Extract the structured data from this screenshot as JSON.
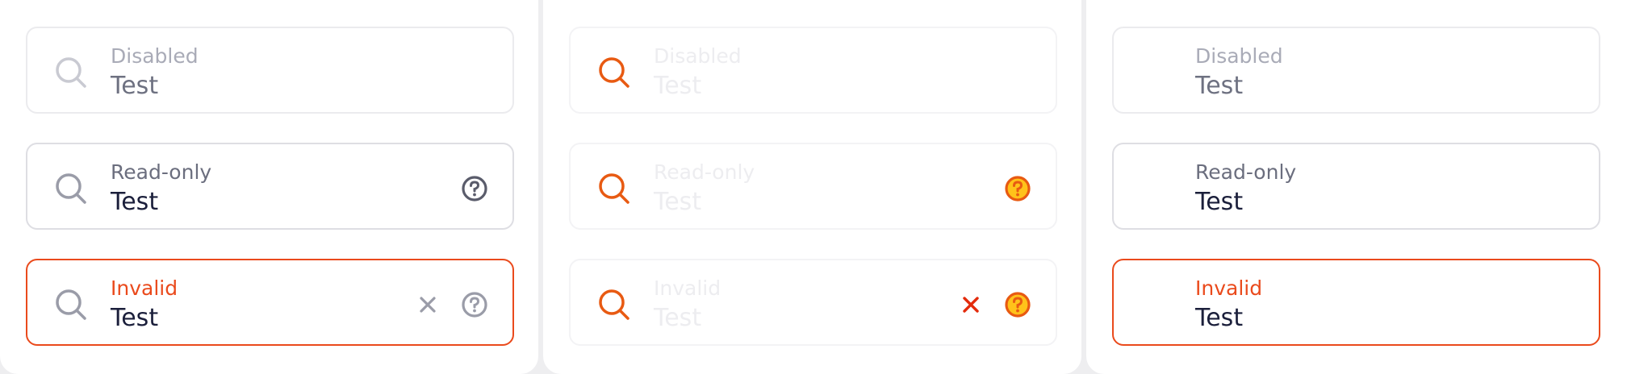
{
  "colors": {
    "accent_invalid": "#ea4a1c",
    "icon_orange": "#e85a12",
    "icon_gray": "#9a9ca8",
    "icon_dark": "#5a5c6b",
    "text_dark": "#1b1f3b",
    "label_gray": "#6b6e7e",
    "border": "#dedee3"
  },
  "icons": {
    "search": "search-icon",
    "help": "help-circle-icon",
    "clear": "close-icon"
  },
  "columns": [
    {
      "fields": [
        {
          "label": "Disabled",
          "value": "Test",
          "state": "disabled"
        },
        {
          "label": "Read-only",
          "value": "Test",
          "state": "readonly"
        },
        {
          "label": "Invalid",
          "value": "Test",
          "state": "invalid"
        }
      ]
    },
    {
      "fields": [
        {
          "label": "Disabled",
          "value": "Test",
          "state": "disabled"
        },
        {
          "label": "Read-only",
          "value": "Test",
          "state": "readonly"
        },
        {
          "label": "Invalid",
          "value": "Test",
          "state": "invalid"
        }
      ]
    },
    {
      "fields": [
        {
          "label": "Disabled",
          "value": "Test",
          "state": "disabled"
        },
        {
          "label": "Read-only",
          "value": "Test",
          "state": "readonly"
        },
        {
          "label": "Invalid",
          "value": "Test",
          "state": "invalid"
        }
      ]
    }
  ]
}
